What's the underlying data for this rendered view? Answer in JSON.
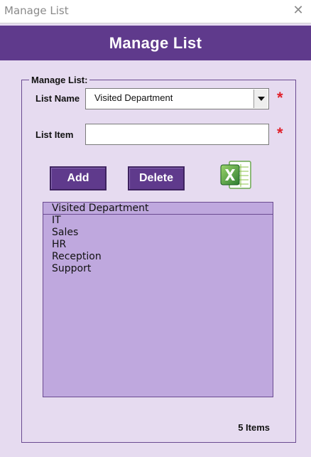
{
  "window": {
    "title": "Manage List",
    "close_glyph": "✕"
  },
  "header": {
    "title": "Manage List"
  },
  "form": {
    "group_label": "Manage List:",
    "list_name_label": "List Name",
    "list_name_value": "Visited Department",
    "list_item_label": "List Item",
    "list_item_value": "",
    "required_mark": "*"
  },
  "buttons": {
    "add_label": "Add",
    "delete_label": "Delete",
    "excel_icon": "excel-icon"
  },
  "list": {
    "header": "Visited Department",
    "items": [
      "IT",
      "Sales",
      "HR",
      "Reception",
      "Support"
    ]
  },
  "footer": {
    "count_label": "5 Items"
  },
  "colors": {
    "accent": "#5f3a8c",
    "background": "#e6dbf0",
    "list_background": "#bfa8de",
    "required": "#e0202a"
  }
}
